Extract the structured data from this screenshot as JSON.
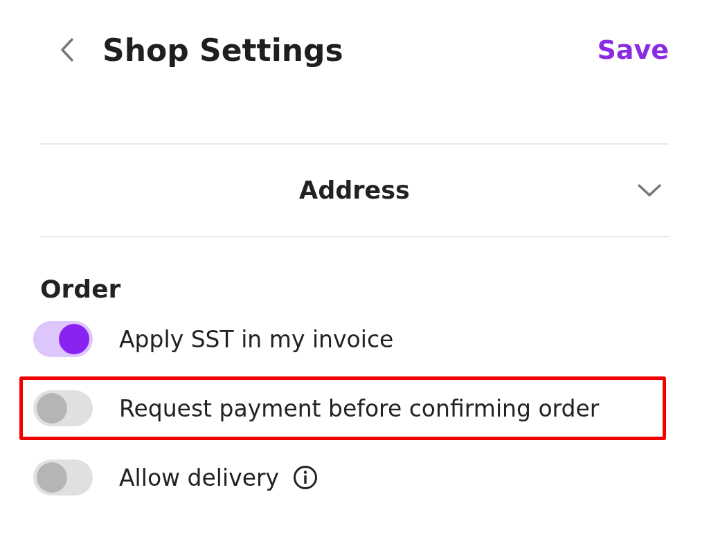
{
  "header": {
    "title": "Shop Settings",
    "action": "Save"
  },
  "address": {
    "label": "Address",
    "expanded": false
  },
  "order": {
    "title": "Order",
    "options": [
      {
        "label": "Apply SST in my invoice",
        "on": true,
        "highlighted": false,
        "info": false
      },
      {
        "label": "Request payment before confirming order",
        "on": false,
        "highlighted": true,
        "info": false
      },
      {
        "label": "Allow delivery",
        "on": false,
        "highlighted": false,
        "info": true
      }
    ]
  }
}
